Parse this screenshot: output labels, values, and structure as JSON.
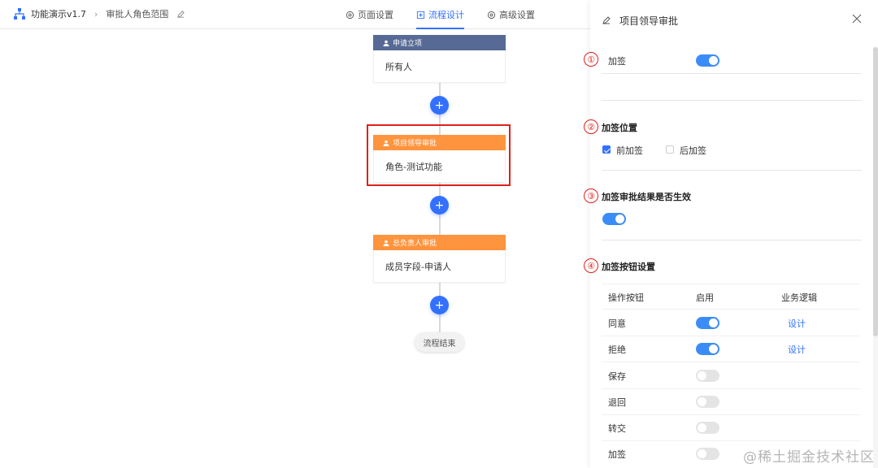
{
  "topbar": {
    "app_name": "功能演示v1.7",
    "breadcrumb_current": "审批人角色范围",
    "tabs": [
      {
        "label": "页面设置",
        "active": false
      },
      {
        "label": "流程设计",
        "active": true
      },
      {
        "label": "高级设置",
        "active": false
      }
    ]
  },
  "flow": {
    "nodes": [
      {
        "header": "申请立项",
        "body": "所有人",
        "color": "#576a95"
      },
      {
        "header": "项目领导审批",
        "body": "角色-测试功能",
        "color": "#ff943e"
      },
      {
        "header": "总负责人审批",
        "body": "成员字段-申请人",
        "color": "#ff943e"
      }
    ],
    "add_label": "+",
    "end_label": "流程结束"
  },
  "panel": {
    "title": "项目领导审批",
    "sections": [
      {
        "marker": "①",
        "label": "加签",
        "enabled": true
      },
      {
        "marker": "②",
        "title": "加签位置",
        "options": [
          {
            "label": "前加签",
            "checked": true
          },
          {
            "label": "后加签",
            "checked": false
          }
        ]
      },
      {
        "marker": "③",
        "title": "加签审批结果是否生效",
        "enabled": true
      },
      {
        "marker": "④",
        "title": "加签按钮设置"
      }
    ],
    "table": {
      "headers": [
        "操作按钮",
        "启用",
        "业务逻辑"
      ],
      "rows": [
        {
          "name": "同意",
          "enabled": true,
          "logic": "设计"
        },
        {
          "name": "拒绝",
          "enabled": true,
          "logic": "设计"
        },
        {
          "name": "保存",
          "enabled": false,
          "logic": ""
        },
        {
          "name": "退回",
          "enabled": false,
          "logic": ""
        },
        {
          "name": "转交",
          "enabled": false,
          "logic": ""
        },
        {
          "name": "加签",
          "enabled": false,
          "logic": ""
        }
      ]
    }
  },
  "watermark": "@稀土掘金技术社区",
  "colors": {
    "accent": "#3370ff",
    "node_start": "#576a95",
    "node_approver": "#ff943e",
    "annotation": "#e0201b"
  }
}
